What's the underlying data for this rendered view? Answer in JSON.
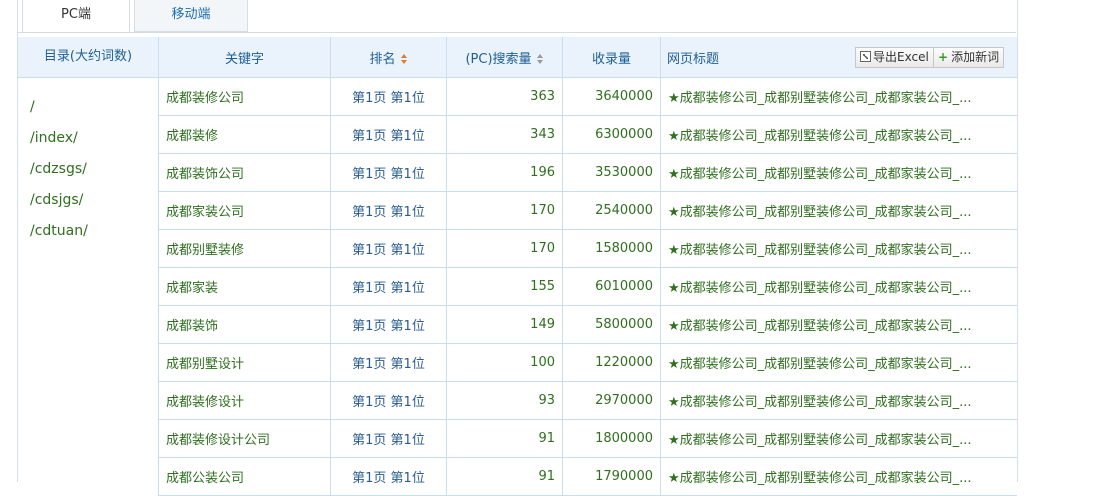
{
  "tabs": [
    {
      "label": "PC端",
      "active": true
    },
    {
      "label": "移动端",
      "active": false
    }
  ],
  "directory": {
    "header": "目录(大约词数)",
    "items": [
      "/",
      "/index/",
      "/cdzsgs/",
      "/cdsjgs/",
      "/cdtuan/"
    ]
  },
  "table": {
    "headers": {
      "keyword": "关键字",
      "rank": "排名",
      "search_volume": "(PC)搜索量",
      "indexed": "收录量",
      "page_title": "网页标题"
    },
    "export_label": "导出Excel",
    "add_label": "添加新词",
    "rows": [
      {
        "keyword": "成都装修公司",
        "rank": "第1页 第1位",
        "search": "363",
        "indexed": "3640000",
        "title": "★成都装修公司_成都别墅装修公司_成都家装公司_..."
      },
      {
        "keyword": "成都装修",
        "rank": "第1页 第1位",
        "search": "343",
        "indexed": "6300000",
        "title": "★成都装修公司_成都别墅装修公司_成都家装公司_..."
      },
      {
        "keyword": "成都装饰公司",
        "rank": "第1页 第1位",
        "search": "196",
        "indexed": "3530000",
        "title": "★成都装修公司_成都别墅装修公司_成都家装公司_..."
      },
      {
        "keyword": "成都家装公司",
        "rank": "第1页 第1位",
        "search": "170",
        "indexed": "2540000",
        "title": "★成都装修公司_成都别墅装修公司_成都家装公司_..."
      },
      {
        "keyword": "成都别墅装修",
        "rank": "第1页 第1位",
        "search": "170",
        "indexed": "1580000",
        "title": "★成都装修公司_成都别墅装修公司_成都家装公司_..."
      },
      {
        "keyword": "成都家装",
        "rank": "第1页 第1位",
        "search": "155",
        "indexed": "6010000",
        "title": "★成都装修公司_成都别墅装修公司_成都家装公司_..."
      },
      {
        "keyword": "成都装饰",
        "rank": "第1页 第1位",
        "search": "149",
        "indexed": "5800000",
        "title": "★成都装修公司_成都别墅装修公司_成都家装公司_..."
      },
      {
        "keyword": "成都别墅设计",
        "rank": "第1页 第1位",
        "search": "100",
        "indexed": "1220000",
        "title": "★成都装修公司_成都别墅装修公司_成都家装公司_..."
      },
      {
        "keyword": "成都装修设计",
        "rank": "第1页 第1位",
        "search": "93",
        "indexed": "2970000",
        "title": "★成都装修公司_成都别墅装修公司_成都家装公司_..."
      },
      {
        "keyword": "成都装修设计公司",
        "rank": "第1页 第1位",
        "search": "91",
        "indexed": "1800000",
        "title": "★成都装修公司_成都别墅装修公司_成都家装公司_..."
      },
      {
        "keyword": "成都公装公司",
        "rank": "第1页 第1位",
        "search": "91",
        "indexed": "1790000",
        "title": "★成都装修公司_成都别墅装修公司_成都家装公司_..."
      }
    ]
  }
}
